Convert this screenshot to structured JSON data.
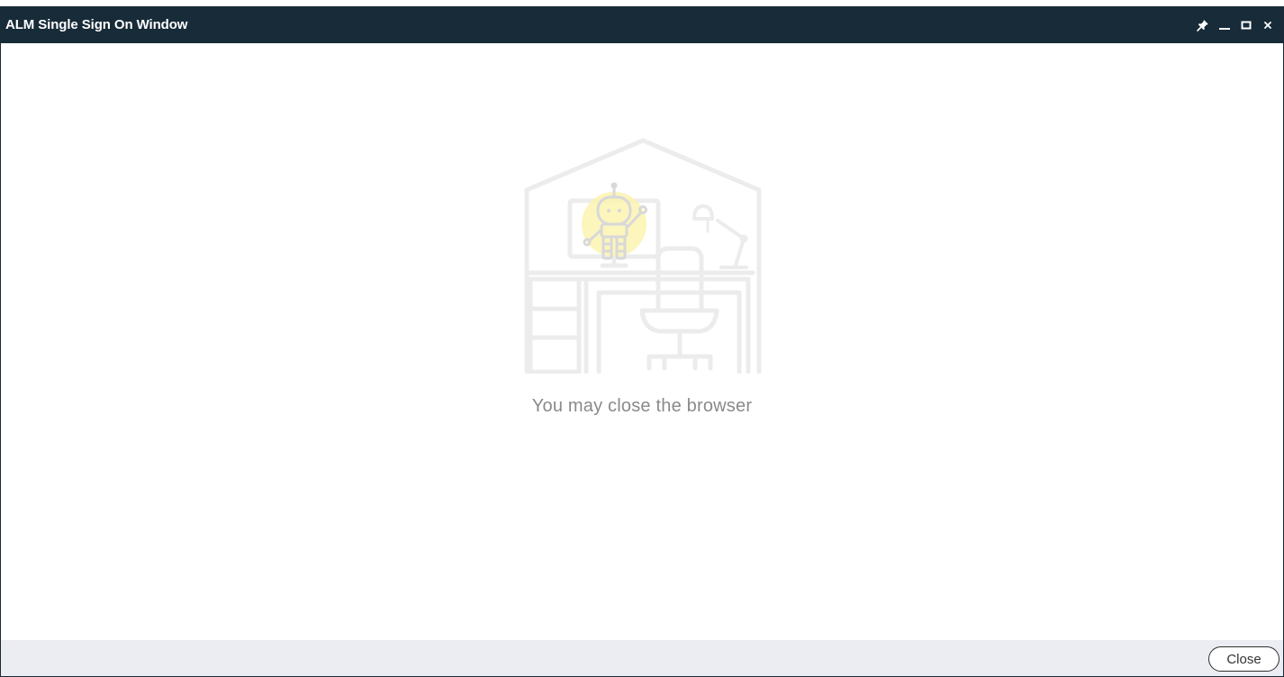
{
  "window": {
    "title": "ALM Single Sign On Window",
    "controls": {
      "pin_icon": "pin-icon",
      "minimize_icon": "minimize-icon",
      "maximize_icon": "maximize-icon",
      "close_icon": "close-icon"
    }
  },
  "main": {
    "illustration_icon": "robot-at-desk-illustration",
    "message": "You may close the browser"
  },
  "footer": {
    "close_label": "Close"
  },
  "colors": {
    "titlebar": "#172b38",
    "footer": "#ebedf2",
    "illustration_stroke": "#ececec",
    "robot_glow": "#fcf3b0"
  }
}
